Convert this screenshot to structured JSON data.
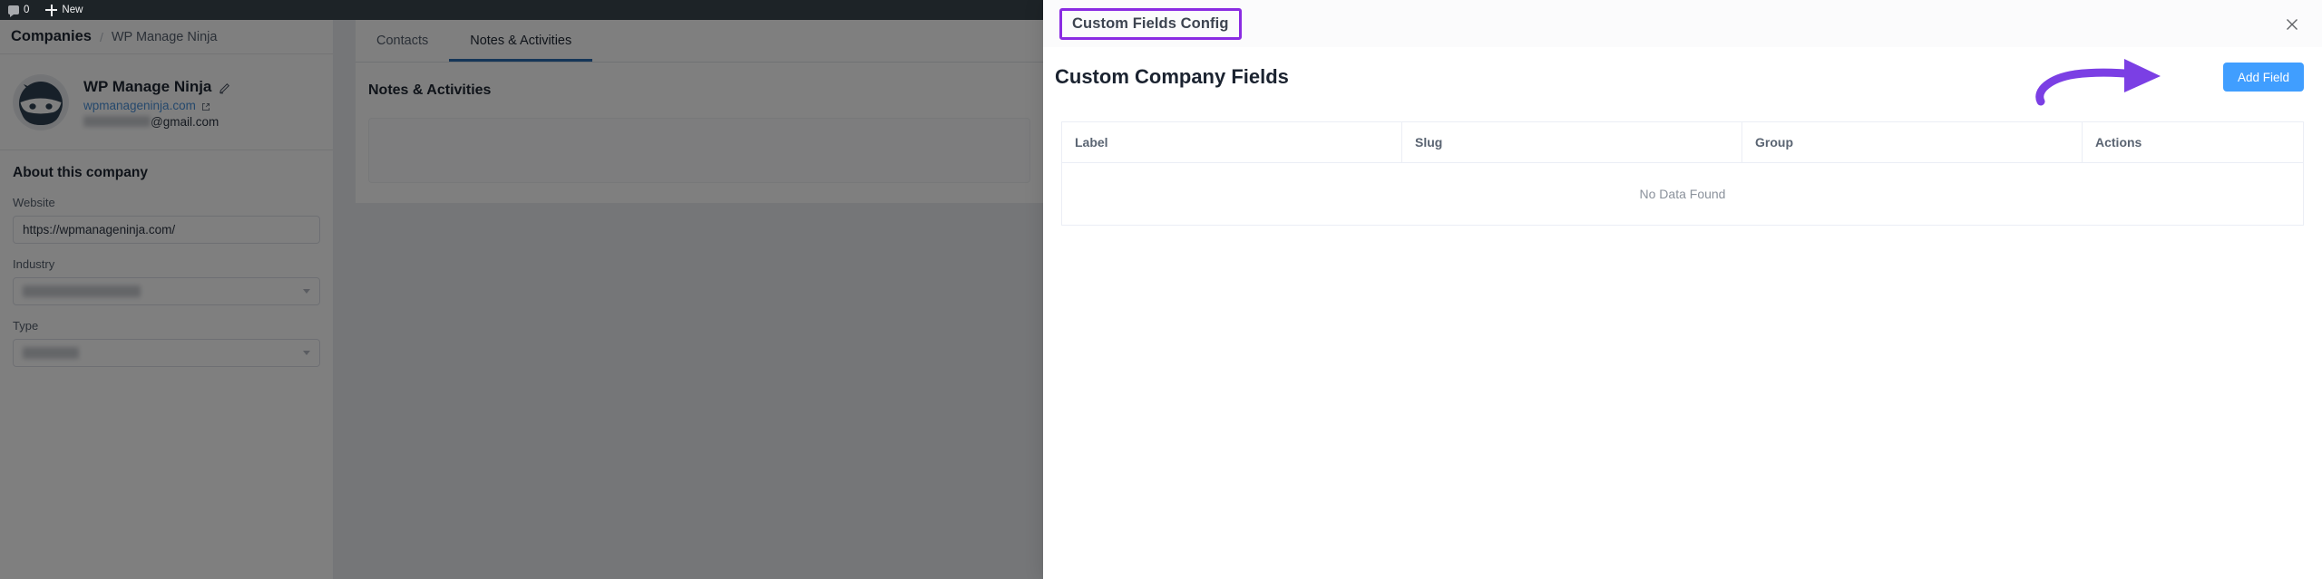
{
  "adminbar": {
    "comments_icon": "comment-bubble-icon",
    "comments_count": "0",
    "new_icon": "plus-icon",
    "new_label": "New"
  },
  "breadcrumb": {
    "root": "Companies",
    "separator": "/",
    "current": "WP Manage Ninja"
  },
  "company": {
    "avatar_icon": "ninja-avatar",
    "name": "WP Manage Ninja",
    "edit_icon": "pencil-icon",
    "website_link": "wpmanageninja.com",
    "external_link_icon": "external-link-icon",
    "email_redacted": true,
    "email_suffix": "@gmail.com"
  },
  "about": {
    "title": "About this company",
    "fields": [
      {
        "label": "Website",
        "value": "https://wpmanageninja.com/",
        "type": "text"
      },
      {
        "label": "Industry",
        "value": "",
        "type": "select",
        "redacted": true
      },
      {
        "label": "Type",
        "value": "",
        "type": "select",
        "redacted": true
      }
    ]
  },
  "center": {
    "tabs": [
      {
        "label": "Contacts",
        "active": false
      },
      {
        "label": "Notes & Activities",
        "active": true
      }
    ],
    "panel_title": "Notes & Activities"
  },
  "modal": {
    "title": "Custom Fields Config",
    "title_highlight_color": "#8a2be2",
    "close_icon": "close-icon",
    "section_title": "Custom Company Fields",
    "add_button_label": "Add Field",
    "add_button_color": "#409eff",
    "annotation_arrow_icon": "curved-arrow-icon",
    "annotation_arrow_color": "#7b3fe4",
    "table": {
      "columns": [
        "Label",
        "Slug",
        "Group",
        "Actions"
      ],
      "rows": [],
      "empty_message": "No Data Found"
    }
  }
}
